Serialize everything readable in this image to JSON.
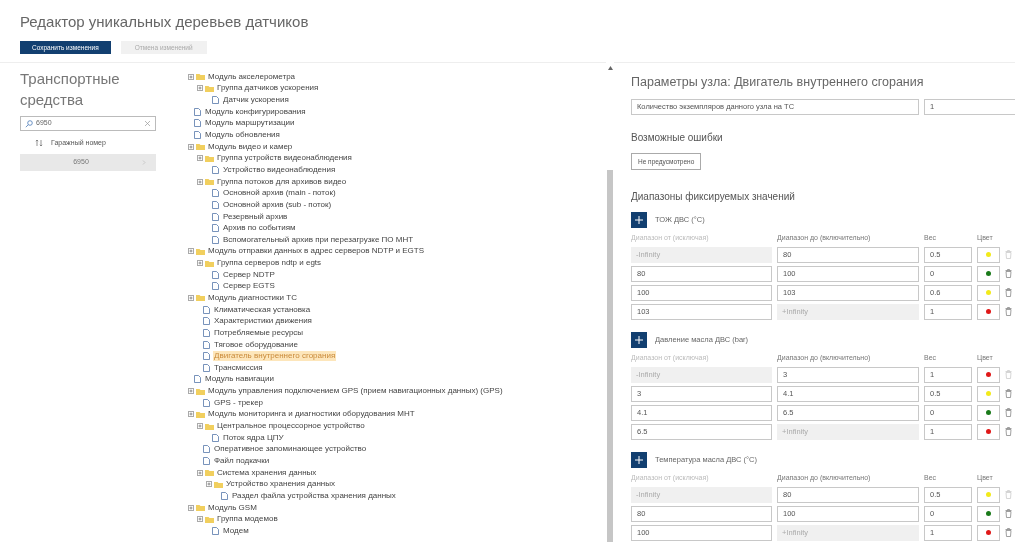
{
  "page_title": "Редактор уникальных деревьев датчиков",
  "toolbar": [
    {
      "label": "Сохранить изменения",
      "kind": "primary"
    },
    {
      "label": "Отмена изменений",
      "kind": "secondary"
    }
  ],
  "vehicles": {
    "title": "Транспортные средства",
    "search": {
      "value": "6950"
    },
    "sort_column": "Гаражный номер",
    "rows": [
      {
        "label": "6950",
        "selected": true
      }
    ]
  },
  "tree": [
    {
      "label": "Модуль акселерометра",
      "kind": "folder",
      "selected": false,
      "children": [
        {
          "label": "Группа датчиков ускорения",
          "kind": "folder",
          "selected": false,
          "children": [
            {
              "label": "Датчик ускорения",
              "kind": "file",
              "selected": false
            }
          ]
        }
      ]
    },
    {
      "label": "Модуль конфигурирования",
      "kind": "file",
      "selected": false
    },
    {
      "label": "Модуль маршрутизации",
      "kind": "file",
      "selected": false
    },
    {
      "label": "Модуль обновления",
      "kind": "file",
      "selected": false
    },
    {
      "label": "Модуль видео и камер",
      "kind": "folder",
      "selected": false,
      "children": [
        {
          "label": "Группа устройств видеонаблюдения",
          "kind": "folder",
          "selected": false,
          "children": [
            {
              "label": "Устройство видеонаблюдения",
              "kind": "file",
              "selected": false
            }
          ]
        },
        {
          "label": "Группа потоков для архивов видео",
          "kind": "folder",
          "selected": false,
          "children": [
            {
              "label": "Основной архив (main - поток)",
              "kind": "file",
              "selected": false
            },
            {
              "label": "Основной архив (sub - поток)",
              "kind": "file",
              "selected": false
            },
            {
              "label": "Резервный архив",
              "kind": "file",
              "selected": false
            },
            {
              "label": "Архив по событиям",
              "kind": "file",
              "selected": false
            },
            {
              "label": "Вспомогательный архив при перезагрузке ПО МНТ",
              "kind": "file",
              "selected": false
            }
          ]
        }
      ]
    },
    {
      "label": "Модуль отправки данных в адрес серверов NDTP и EGTS",
      "kind": "folder",
      "selected": false,
      "children": [
        {
          "label": "Группа серверов ndtp и egts",
          "kind": "folder",
          "selected": false,
          "children": [
            {
              "label": "Сервер NDTP",
              "kind": "file",
              "selected": false
            },
            {
              "label": "Сервер EGTS",
              "kind": "file",
              "selected": false
            }
          ]
        }
      ]
    },
    {
      "label": "Модуль диагностики ТС",
      "kind": "folder",
      "selected": false,
      "children": [
        {
          "label": "Климатическая установка",
          "kind": "file",
          "selected": false
        },
        {
          "label": "Характеристики движения",
          "kind": "file",
          "selected": false
        },
        {
          "label": "Потребляемые ресурсы",
          "kind": "file",
          "selected": false
        },
        {
          "label": "Тяговое оборудование",
          "kind": "file",
          "selected": false
        },
        {
          "label": "Двигатель внутреннего сгорания",
          "kind": "file",
          "selected": true
        },
        {
          "label": "Трансмиссия",
          "kind": "file",
          "selected": false
        }
      ]
    },
    {
      "label": "Модуль навигации",
      "kind": "file",
      "selected": false
    },
    {
      "label": "Модуль управления подключением GPS (прием навигационных данных) (GPS)",
      "kind": "folder",
      "selected": false,
      "children": [
        {
          "label": "GPS - трекер",
          "kind": "file",
          "selected": false
        }
      ]
    },
    {
      "label": "Модуль мониторинга и диагностики оборудования МНТ",
      "kind": "folder",
      "selected": false,
      "children": [
        {
          "label": "Центральное процессорное устройство",
          "kind": "folder",
          "selected": false,
          "children": [
            {
              "label": "Поток ядра ЦПУ",
              "kind": "file",
              "selected": false
            }
          ]
        },
        {
          "label": "Оперативное запоминающее устройство",
          "kind": "file",
          "selected": false
        },
        {
          "label": "Файл подкачки",
          "kind": "file",
          "selected": false
        },
        {
          "label": "Система хранения данных",
          "kind": "folder",
          "selected": false,
          "children": [
            {
              "label": "Устройство хранения данных",
              "kind": "folder",
              "selected": false,
              "children": [
                {
                  "label": "Раздел файла устройства хранения данных",
                  "kind": "file",
                  "selected": false
                }
              ]
            }
          ]
        }
      ]
    },
    {
      "label": "Модуль GSM",
      "kind": "folder",
      "selected": false,
      "children": [
        {
          "label": "Группа модемов",
          "kind": "folder",
          "selected": false,
          "children": [
            {
              "label": "Модем",
              "kind": "file",
              "selected": false
            }
          ]
        }
      ]
    }
  ],
  "node_params": {
    "title": "Параметры узла: Двигатель внутреннего сгорания",
    "count_label": "Количество экземпляров данного узла на ТС",
    "count_value": "1",
    "errors_title": "Возможные ошибки",
    "errors_button": "Не предусмотрено",
    "ranges_title": "Диапазоны фиксируемых значений",
    "groups": [
      {
        "title": "ТОЖ ДВС (°C)",
        "columns": [
          "Диапазон от (исключая)",
          "Диапазон до (включительно)",
          "Вес",
          "Цвет"
        ],
        "rows": [
          {
            "from": "-Infinity",
            "to": "80",
            "weight": "0.5",
            "color": "#f2ea1a",
            "from_disabled": true,
            "to_disabled": false
          },
          {
            "from": "80",
            "to": "100",
            "weight": "0",
            "color": "#1a7a1a",
            "from_disabled": false,
            "to_disabled": false
          },
          {
            "from": "100",
            "to": "103",
            "weight": "0.6",
            "color": "#f2ea1a",
            "from_disabled": false,
            "to_disabled": false
          },
          {
            "from": "103",
            "to": "+Infinity",
            "weight": "1",
            "color": "#e01818",
            "from_disabled": false,
            "to_disabled": true
          }
        ]
      },
      {
        "title": "Давление масла ДВС (bar)",
        "columns": [
          "Диапазон от (исключая)",
          "Диапазон до (включительно)",
          "Вес",
          "Цвет"
        ],
        "rows": [
          {
            "from": "-Infinity",
            "to": "3",
            "weight": "1",
            "color": "#e01818",
            "from_disabled": true,
            "to_disabled": false
          },
          {
            "from": "3",
            "to": "4.1",
            "weight": "0.5",
            "color": "#f2ea1a",
            "from_disabled": false,
            "to_disabled": false
          },
          {
            "from": "4.1",
            "to": "6.5",
            "weight": "0",
            "color": "#1a7a1a",
            "from_disabled": false,
            "to_disabled": false
          },
          {
            "from": "6.5",
            "to": "+Infinity",
            "weight": "1",
            "color": "#e01818",
            "from_disabled": false,
            "to_disabled": true
          }
        ]
      },
      {
        "title": "Температура масла ДВС (°C)",
        "columns": [
          "Диапазон от (исключая)",
          "Диапазон до (включительно)",
          "Вес",
          "Цвет"
        ],
        "rows": [
          {
            "from": "-Infinity",
            "to": "80",
            "weight": "0.5",
            "color": "#f2ea1a",
            "from_disabled": true,
            "to_disabled": false
          },
          {
            "from": "80",
            "to": "100",
            "weight": "0",
            "color": "#1a7a1a",
            "from_disabled": false,
            "to_disabled": false
          },
          {
            "from": "100",
            "to": "+Infinity",
            "weight": "1",
            "color": "#e01818",
            "from_disabled": false,
            "to_disabled": true
          }
        ]
      }
    ]
  }
}
